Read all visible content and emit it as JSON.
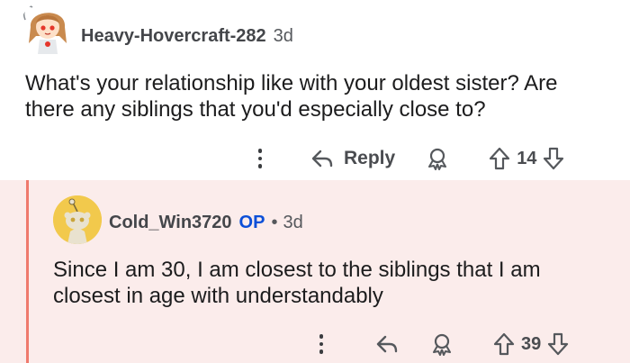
{
  "comments": [
    {
      "author": "Heavy-Hovercraft-282",
      "age": "3d",
      "body": "What's your relationship like with your oldest sister? Are there any siblings that you'd especially close to?",
      "reply_label": "Reply",
      "vote_count": "14"
    },
    {
      "author": "Cold_Win3720",
      "op_badge": "OP",
      "separator": "•",
      "age": "3d",
      "body": "Since I am 30, I am closest to the siblings that I am closest in age with understandably",
      "vote_count": "39"
    }
  ],
  "icons": {
    "more": "more-options-icon",
    "reply": "reply-arrow-icon",
    "award": "award-icon",
    "upvote": "upvote-arrow-icon",
    "downvote": "downvote-arrow-icon"
  },
  "colors": {
    "thread_highlight_bg": "#fbeceb",
    "thread_line": "#ef7a6d",
    "op_badge": "#0b4fd8",
    "snoo_avatar_bg": "#f2c94c"
  }
}
